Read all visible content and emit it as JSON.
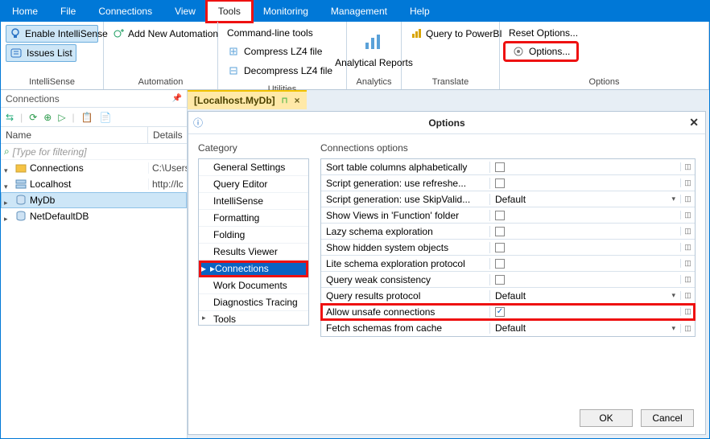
{
  "menu": {
    "home": "Home",
    "file": "File",
    "connections": "Connections",
    "view": "View",
    "tools": "Tools",
    "monitoring": "Monitoring",
    "management": "Management",
    "help": "Help"
  },
  "ribbon": {
    "intellisense": {
      "enable": "Enable IntelliSense",
      "issues": "Issues List",
      "label": "IntelliSense"
    },
    "automation": {
      "add": "Add New Automation",
      "label": "Automation"
    },
    "utilities": {
      "cmd": "Command-line tools",
      "compress": "Compress LZ4 file",
      "decompress": "Decompress LZ4 file",
      "label": "Utilities"
    },
    "analytics": {
      "btn": "Analytical Reports",
      "label": "Analytics"
    },
    "translate": {
      "btn": "Query to PowerBI",
      "label": "Translate"
    },
    "options": {
      "reset": "Reset Options...",
      "options": "Options...",
      "label": "Options"
    }
  },
  "side": {
    "title": "Connections",
    "col1": "Name",
    "col2": "Details",
    "filter": "[Type for filtering]",
    "root": "Connections",
    "root_det": "C:\\Users",
    "n1": "Localhost",
    "n1_det": "http://lc",
    "n2": "MyDb",
    "n3": "NetDefaultDB"
  },
  "doc": {
    "tab": "[Localhost.MyDb]"
  },
  "dialog": {
    "title": "Options",
    "cat_label": "Category",
    "cats": {
      "c0": "General Settings",
      "c1": "Query Editor",
      "c2": "IntelliSense",
      "c3": "Formatting",
      "c4": "Folding",
      "c5": "Results Viewer",
      "c6": "Connections",
      "c7": "Work Documents",
      "c8": "Diagnostics Tracing",
      "c9": "Tools"
    },
    "opt_label": "Connections options",
    "opts": {
      "o0": {
        "n": "Sort table columns alphabetically",
        "v": "",
        "chk": false
      },
      "o1": {
        "n": "Script generation: use refreshe...",
        "v": "",
        "chk": false
      },
      "o2": {
        "n": "Script generation: use SkipValid...",
        "v": "Default",
        "chk": null
      },
      "o3": {
        "n": "Show Views in 'Function' folder",
        "v": "",
        "chk": false
      },
      "o4": {
        "n": "Lazy schema exploration",
        "v": "",
        "chk": false
      },
      "o5": {
        "n": "Show hidden system objects",
        "v": "",
        "chk": false
      },
      "o6": {
        "n": "Lite schema exploration protocol",
        "v": "",
        "chk": false
      },
      "o7": {
        "n": "Query weak consistency",
        "v": "",
        "chk": false
      },
      "o8": {
        "n": "Query results protocol",
        "v": "Default",
        "chk": null
      },
      "o9": {
        "n": "Allow unsafe connections",
        "v": "",
        "chk": true
      },
      "o10": {
        "n": "Fetch schemas from cache",
        "v": "Default",
        "chk": null
      }
    },
    "ok": "OK",
    "cancel": "Cancel"
  }
}
